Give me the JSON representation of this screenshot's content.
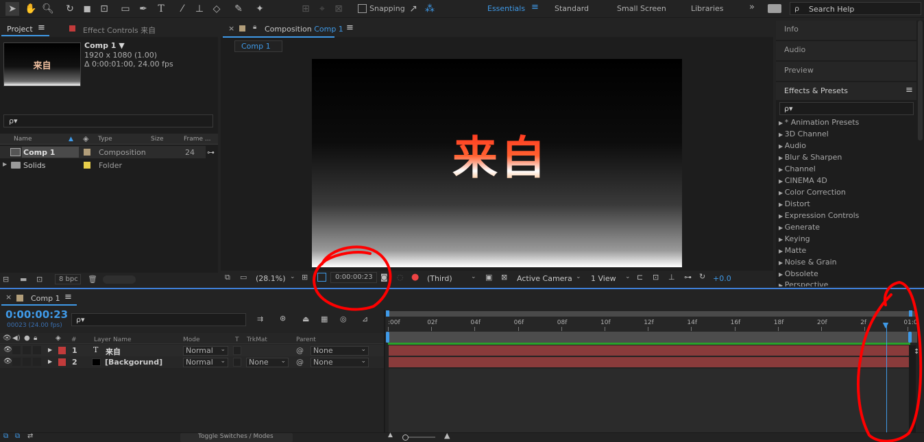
{
  "toolbar": {
    "snapping_label": "Snapping",
    "workspaces": [
      "Essentials",
      "Standard",
      "Small Screen",
      "Libraries"
    ],
    "active_workspace": "Essentials",
    "more_label": "»",
    "search_help_placeholder": "Search Help"
  },
  "project_panel": {
    "tab_project": "Project",
    "tab_effect_controls": "Effect Controls 来自",
    "thumbnail_text": "来自",
    "comp_name": "Comp 1 ▼",
    "comp_res": "1920 x 1080 (1.00)",
    "comp_duration": "Δ 0:00:01:00, 24.00 fps",
    "search_placeholder": "ρ▾",
    "columns": [
      "Name",
      "Type",
      "Size",
      "Frame ..."
    ],
    "items": [
      {
        "name": "Comp 1",
        "type": "Composition",
        "size": "",
        "frame": "24",
        "color": "#b29e7a"
      },
      {
        "name": "Solids",
        "type": "Folder",
        "size": "",
        "frame": "",
        "color": "#e8cf4a"
      }
    ],
    "bpc_label": "8 bpc"
  },
  "composition_panel": {
    "tab_prefix": "Composition",
    "tab_comp": "Comp 1",
    "comp_chip": "Comp 1",
    "canvas_text": "来自",
    "zoom": "(28.1%)",
    "timecode": "0:00:00:23",
    "resolution": "(Third)",
    "camera": "Active Camera",
    "views": "1 View",
    "exposure": "+0.0"
  },
  "right_panel": {
    "info": "Info",
    "audio": "Audio",
    "preview": "Preview",
    "effects_title": "Effects & Presets",
    "search_placeholder": "ρ▾",
    "categories": [
      "* Animation Presets",
      "3D Channel",
      "Audio",
      "Blur & Sharpen",
      "Channel",
      "CINEMA 4D",
      "Color Correction",
      "Distort",
      "Expression Controls",
      "Generate",
      "Keying",
      "Matte",
      "Noise & Grain",
      "Obsolete",
      "Perspective"
    ]
  },
  "timeline": {
    "tab": "Comp 1",
    "timecode": "0:00:00:23",
    "frame_info": "00023 (24.00 fps)",
    "search_placeholder": "ρ▾",
    "columns": {
      "name": "Layer Name",
      "mode": "Mode",
      "t": "T",
      "trkmat": "TrkMat",
      "parent": "Parent",
      "hash": "#"
    },
    "layers": [
      {
        "num": "1",
        "type_icon": "T",
        "name": "来自",
        "mode": "Normal",
        "trkmat": "",
        "parent": "None",
        "color": "#c23b3b"
      },
      {
        "num": "2",
        "type_icon": "",
        "name": "[Backgorund]",
        "mode": "Normal",
        "trkmat": "None",
        "parent": "None",
        "color": "#c23b3b"
      }
    ],
    "ruler": [
      ":00f",
      "02f",
      "04f",
      "06f",
      "08f",
      "10f",
      "12f",
      "14f",
      "16f",
      "18f",
      "20f",
      "2f",
      "01:0"
    ],
    "toggle_label": "Toggle Switches / Modes",
    "playhead_frame": 23
  },
  "colors": {
    "accent": "#3f9ae8",
    "layer_bar": "#8a3b3b",
    "work_area": "#2aa12a",
    "annotation": "#ff0000"
  }
}
